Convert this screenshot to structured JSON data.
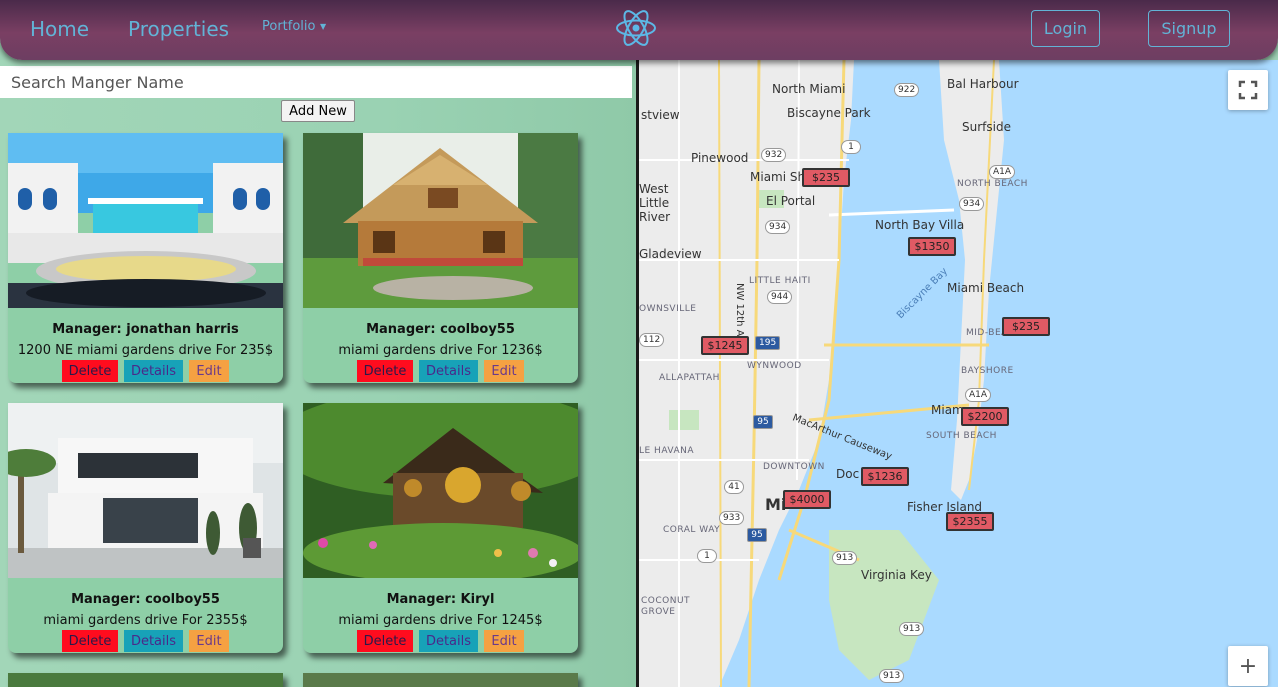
{
  "nav": {
    "home": "Home",
    "properties": "Properties",
    "portfolio": "Portfolio",
    "login": "Login",
    "signup": "Signup",
    "logo_icon": "react-atom-icon"
  },
  "search": {
    "placeholder": "Search Manger Name"
  },
  "add_new": "Add New",
  "cards": [
    {
      "manager": "Manager: jonathan harris",
      "address": "1200 NE miami gardens drive For 235$",
      "delete": "Delete",
      "details": "Details",
      "edit": "Edit"
    },
    {
      "manager": "Manager: coolboy55",
      "address": "miami gardens drive For 1236$",
      "delete": "Delete",
      "details": "Details",
      "edit": "Edit"
    },
    {
      "manager": "Manager: coolboy55",
      "address": "miami gardens drive For 2355$",
      "delete": "Delete",
      "details": "Details",
      "edit": "Edit"
    },
    {
      "manager": "Manager: Kiryl",
      "address": "miami gardens drive For 1245$",
      "delete": "Delete",
      "details": "Details",
      "edit": "Edit"
    }
  ],
  "map": {
    "markers": [
      "$235",
      "$1350",
      "$235",
      "$1245",
      "$2200",
      "$1236",
      "$4000",
      "$2355"
    ],
    "labels": {
      "bal_harbour": "Bal Harbour",
      "north_miami": "North Miami",
      "biscayne_park": "Biscayne Park",
      "surfside": "Surfside",
      "pinewood": "Pinewood",
      "miami_shores": "Miami Sh",
      "west_little_river": "West Little River",
      "el_portal": "El Portal",
      "north_beach": "NORTH BEACH",
      "north_bay_village": "North Bay Villa",
      "gladeview": "Gladeview",
      "little_haiti": "LITTLE HAITI",
      "biscayne_bay": "Biscayne Bay",
      "miami_beach": "Miami Beach",
      "mid_beach": "MID-BEACH",
      "brownsville": "OWNSVILLE",
      "wynwood": "WYNWOOD",
      "allapattah": "ALLAPATTAH",
      "bayshore": "BAYSHORE",
      "miami_beach_s": "Miam",
      "south_beach": "SOUTH BEACH",
      "macarthur": "MacArthur Causeway",
      "little_havana": "LE HAVANA",
      "downtown": "DOWNTOWN",
      "downtown2": "MIAMI",
      "dodge": "Doc",
      "fisher_island": "Fisher Island",
      "coral_way": "CORAL WAY",
      "virginia_key": "Virginia Key",
      "coconut_grove": "COCONUT GROVE",
      "nw12": "NW 12th Ave",
      "istview": "stview",
      "miami_main": "Mi"
    },
    "shields": [
      "922",
      "1",
      "932",
      "A1A",
      "934",
      "934",
      "944",
      "112",
      "195",
      "A1A",
      "95",
      "41",
      "933",
      "95",
      "1",
      "913",
      "913",
      "913"
    ],
    "fullscreen_icon": "fullscreen-icon",
    "zoom_in_icon": "plus-icon"
  }
}
